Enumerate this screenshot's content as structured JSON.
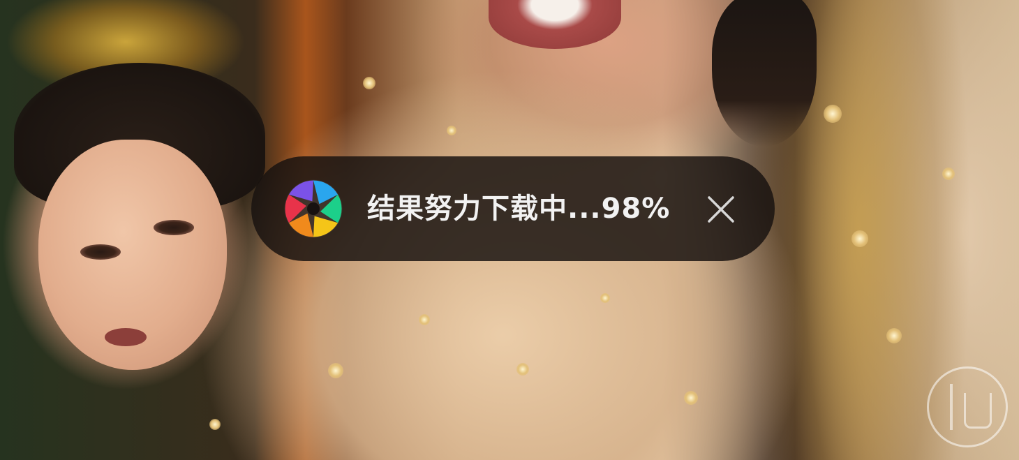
{
  "background": {
    "photo_description_icon": "photo-background"
  },
  "toast": {
    "message": "结果努力下载中...98%",
    "progress_percent": 98,
    "logo_icon": "aperture-icon",
    "close_icon": "close-icon",
    "logo_colors": [
      "#2aa6ee",
      "#1ccf8a",
      "#f5c518",
      "#f08a1c",
      "#e8334a",
      "#7b52e8"
    ],
    "background_color": "#181210",
    "text_color": "#f2f2f2"
  },
  "watermark": {
    "icon": "watermark-seal-icon"
  }
}
